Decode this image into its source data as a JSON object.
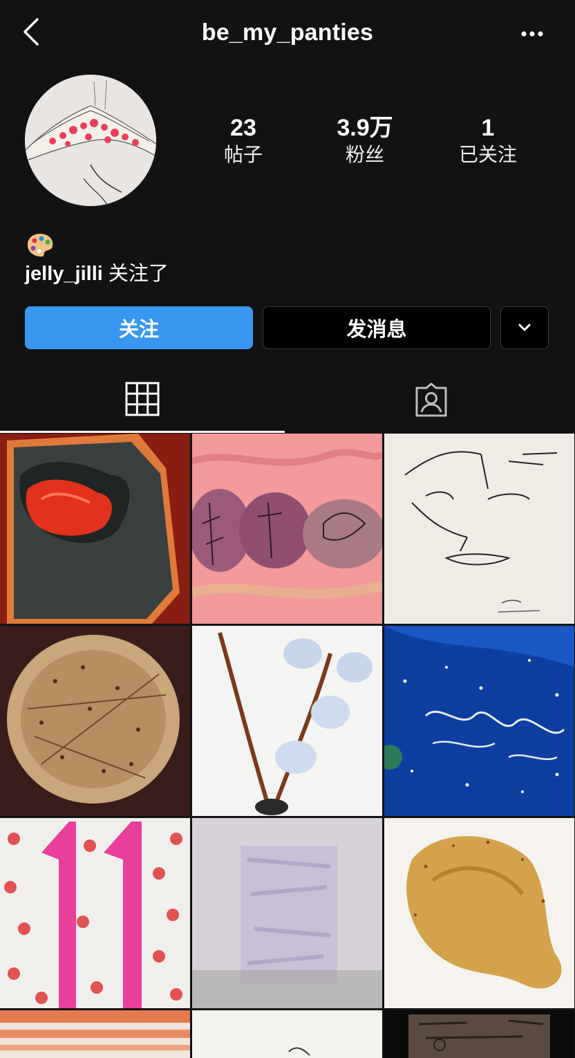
{
  "header": {
    "username": "be_my_panties"
  },
  "stats": [
    {
      "value": "23",
      "label": "帖子"
    },
    {
      "value": "3.9万",
      "label": "粉丝"
    },
    {
      "value": "1",
      "label": "已关注"
    }
  ],
  "bio": {
    "emoji": "🎨"
  },
  "followed_by": {
    "user": "jelly_jilli",
    "text": "关注了"
  },
  "actions": {
    "follow_label": "关注",
    "message_label": "发消息"
  },
  "tabs": [
    {
      "icon": "grid-icon"
    },
    {
      "icon": "tagged-icon"
    }
  ],
  "colors": {
    "background": "#121212",
    "accent": "#3897f0"
  }
}
